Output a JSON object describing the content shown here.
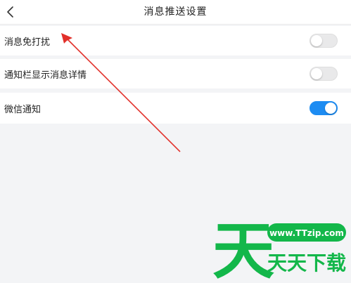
{
  "header": {
    "title": "消息推送设置",
    "back_icon": "chevron-left-icon"
  },
  "settings": [
    {
      "label": "消息免打扰",
      "enabled": false
    },
    {
      "label": "通知栏显示消息详情",
      "enabled": false
    },
    {
      "label": "微信通知",
      "enabled": true
    }
  ],
  "watermark": {
    "site": "www.TTzip.com",
    "big_char": "天",
    "brand": "天天下载"
  },
  "colors": {
    "toggle_on": "#1d8cf2",
    "toggle_off": "#e9e9ea",
    "arrow": "#e2302a",
    "watermark_green": "#13b74a"
  }
}
